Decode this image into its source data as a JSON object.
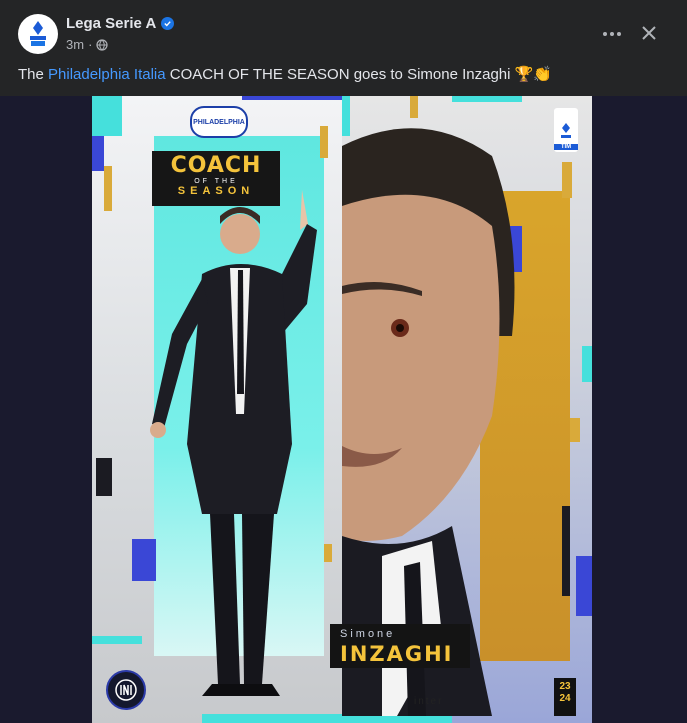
{
  "post": {
    "page_name": "Lega Serie A",
    "time_ago": "3m",
    "separator": "·",
    "caption": {
      "prefix": "The ",
      "link_text": "Philadelphia Italia",
      "suffix": " COACH OF THE SEASON goes to Simone Inzaghi 🏆👏"
    }
  },
  "icons": {
    "more": "more-options-icon",
    "close": "close-icon",
    "audience": "globe-icon",
    "verified": "verified-badge-icon"
  },
  "poster": {
    "brand": "PHILADELPHIA",
    "title_main": "COACH",
    "title_small": "OF THE",
    "title_season": "SEASON",
    "league_tag": "TIM",
    "first_name": "Simone",
    "last_name": "INZAGHI",
    "club": "inter",
    "season_top": "23",
    "season_bottom": "24"
  },
  "colors": {
    "accent_link": "#4599ff",
    "verified": "#1b74e4",
    "gold": "#f4c33b",
    "teal": "#45e0dc",
    "blue": "#3a47d6"
  }
}
